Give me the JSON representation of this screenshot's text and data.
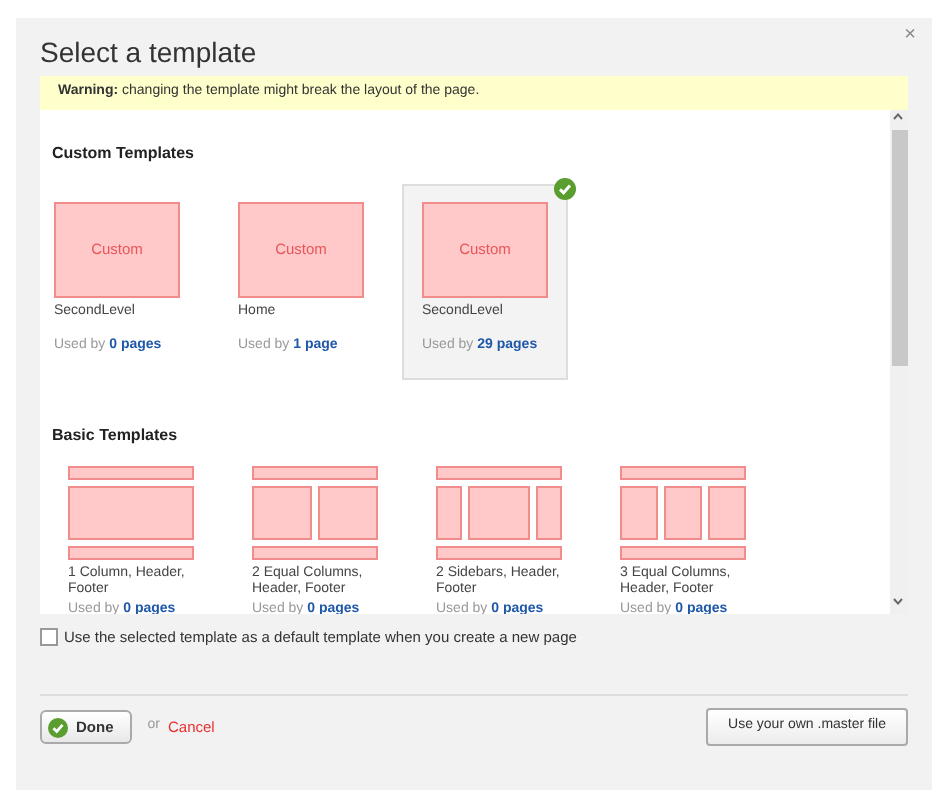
{
  "dialog": {
    "title": "Select a template",
    "close": "×"
  },
  "warning": {
    "label": "Warning:",
    "text": "changing the template might break the layout of the page."
  },
  "custom": {
    "heading": "Custom Templates",
    "items": [
      {
        "thumb": "Custom",
        "name": "SecondLevel",
        "used_prefix": "Used by",
        "used": "0 pages",
        "selected": false
      },
      {
        "thumb": "Custom",
        "name": "Home",
        "used_prefix": "Used by",
        "used": "1 page",
        "selected": false
      },
      {
        "thumb": "Custom",
        "name": "SecondLevel",
        "used_prefix": "Used by",
        "used": "29 pages",
        "selected": true
      }
    ]
  },
  "basic": {
    "heading": "Basic Templates",
    "items": [
      {
        "kind": "one-column",
        "name": "1 Column, Header, Footer",
        "used_prefix": "Used by",
        "used": "0 pages",
        "selected": false
      },
      {
        "kind": "two-columns",
        "name": "2 Equal Columns, Header, Footer",
        "used_prefix": "Used by",
        "used": "0 pages",
        "selected": false
      },
      {
        "kind": "two-sidebars",
        "name": "2 Sidebars, Header, Footer",
        "used_prefix": "Used by",
        "used": "0 pages",
        "selected": false
      },
      {
        "kind": "three-columns",
        "name": "3 Equal Columns, Header, Footer",
        "used_prefix": "Used by",
        "used": "0 pages",
        "selected": false
      }
    ]
  },
  "default_option": {
    "label": "Use the selected template as a default template when you create a new page",
    "checked": false
  },
  "footer": {
    "done": "Done",
    "or": "or",
    "cancel": "Cancel",
    "master": "Use your own .master file"
  }
}
